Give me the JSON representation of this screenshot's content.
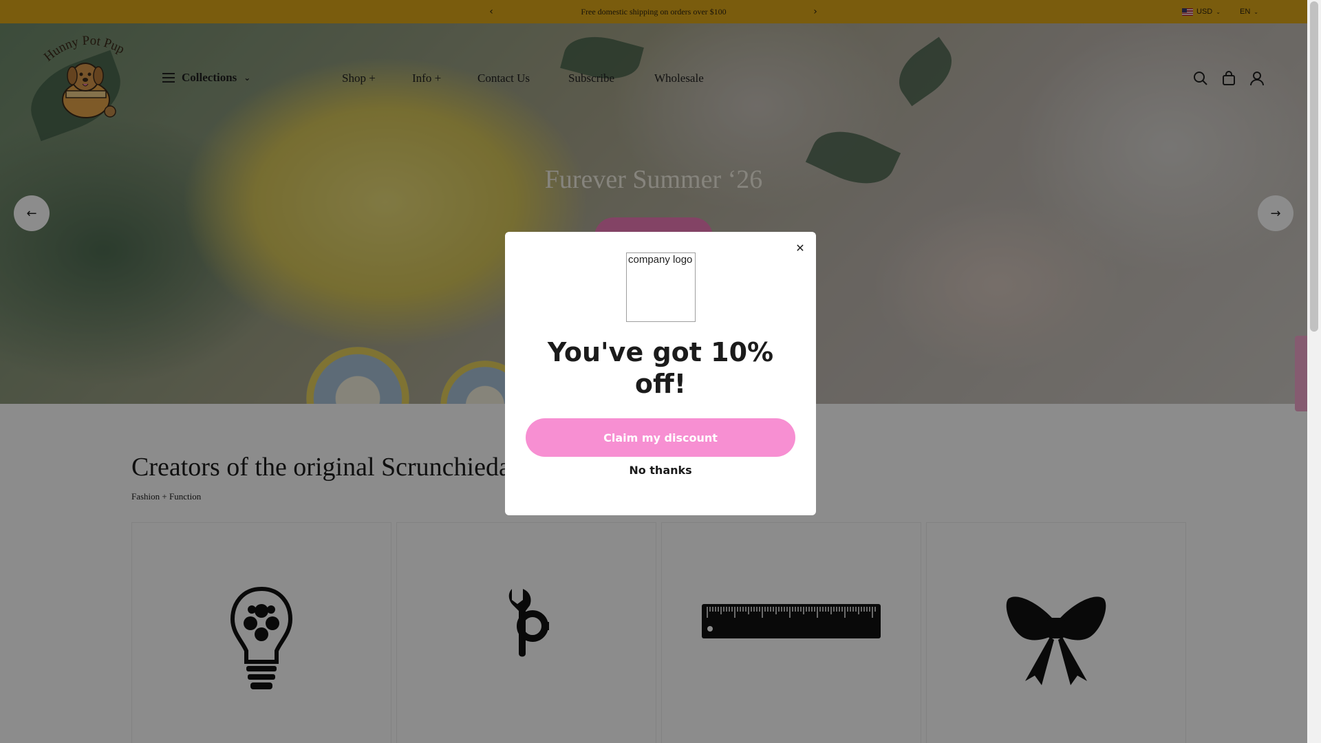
{
  "announcement": {
    "message": "Free domestic shipping on orders over $100",
    "prev_icon": "chevron-left-icon",
    "next_icon": "chevron-right-icon"
  },
  "locale": {
    "currency": "USD",
    "language": "EN"
  },
  "brand": {
    "logo_text": "Hunny Pot Pup"
  },
  "nav": {
    "collections": "Collections",
    "items": [
      {
        "label": "Shop +"
      },
      {
        "label": "Info +"
      },
      {
        "label": "Contact Us"
      },
      {
        "label": "Subscribe"
      },
      {
        "label": "Wholesale"
      }
    ]
  },
  "header_icons": [
    "search-icon",
    "cart-icon",
    "account-icon"
  ],
  "hero": {
    "title": "Furever Summer ‘26"
  },
  "section": {
    "title": "Creators of the original Scrunchiedana®",
    "subtitle": "Fashion + Function"
  },
  "feature_icons": [
    "lightbulb-icon",
    "wrench-gear-icon",
    "ruler-icon",
    "bow-icon"
  ],
  "popup": {
    "logo_alt": "company logo",
    "headline": "You've got 10% off!",
    "claim_label": "Claim my discount",
    "decline_label": "No thanks"
  },
  "colors": {
    "announcement_bg": "#dfa818",
    "accent_pink": "#f78fd2",
    "overlay": "rgba(0,0,0,0.45)"
  }
}
